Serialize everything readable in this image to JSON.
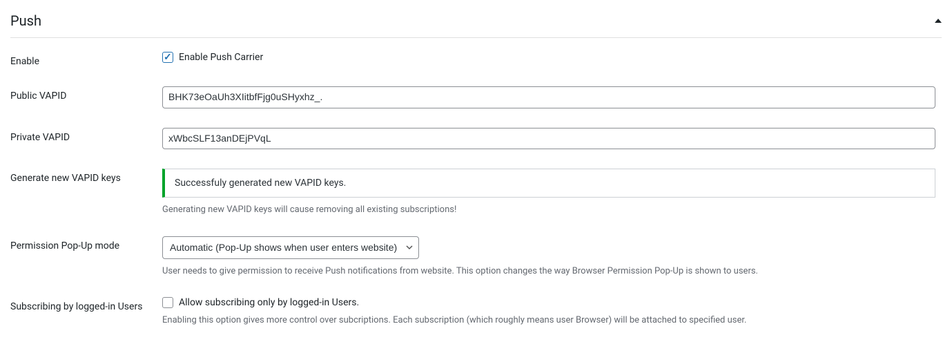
{
  "section": {
    "title": "Push"
  },
  "fields": {
    "enable": {
      "label": "Enable",
      "checkbox_label": "Enable Push Carrier",
      "checked": true
    },
    "public_vapid": {
      "label": "Public VAPID",
      "value": "BHK73eOaUh3XIitbfFjg0uSHyxhz_."
    },
    "private_vapid": {
      "label": "Private VAPID",
      "value": "xWbcSLF13anDEjPVqL"
    },
    "generate": {
      "label": "Generate new VAPID keys",
      "success_message": "Successfuly generated new VAPID keys.",
      "help": "Generating new VAPID keys will cause removing all existing subscriptions!"
    },
    "popup_mode": {
      "label": "Permission Pop-Up mode",
      "selected": "Automatic (Pop-Up shows when user enters website)",
      "help": "User needs to give permission to receive Push notifications from website. This option changes the way Browser Permission Pop-Up is shown to users."
    },
    "subscribing": {
      "label": "Subscribing by logged-in Users",
      "checkbox_label": "Allow subscribing only by logged-in Users.",
      "checked": false,
      "help": "Enabling this option gives more control over subcriptions. Each subscription (which roughly means user Browser) will be attached to specified user."
    }
  }
}
